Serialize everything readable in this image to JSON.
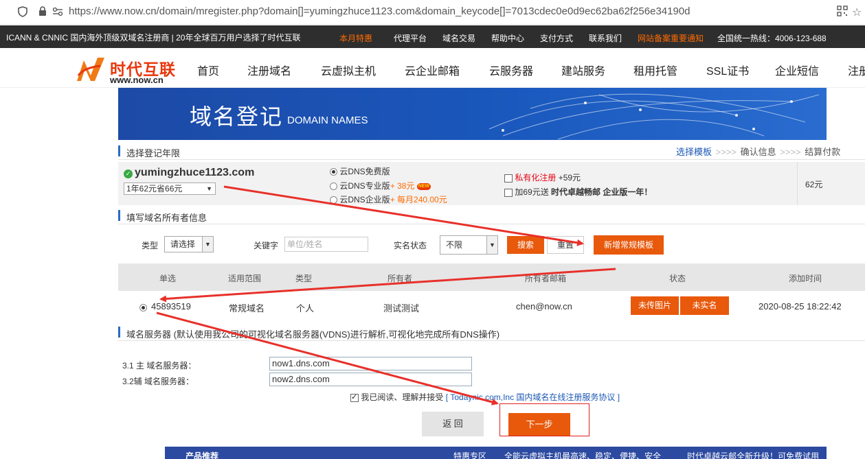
{
  "browser": {
    "url": "https://www.now.cn/domain/mregister.php?domain[]=yumingzhuce1123.com&domain_keycode[]=7013cdec0e0d9ec62ba62f256e34190d"
  },
  "topbar": {
    "slogan": "ICANN & CNNIC 国内海外顶级双域名注册商 | 20年全球百万用户选择了时代互联",
    "links": [
      "本月特惠",
      "代理平台",
      "域名交易",
      "帮助中心",
      "支付方式",
      "联系我们",
      "网站备案重要通知"
    ],
    "hotline": "全国统一热线：4006-123-688"
  },
  "logo": {
    "name": "时代互联",
    "url": "www.now.cn"
  },
  "nav": [
    "首页",
    "注册域名",
    "云虚拟主机",
    "云企业邮箱",
    "云服务器",
    "建站服务",
    "租用托管",
    "SSL证书",
    "企业短信",
    "注册"
  ],
  "banner": {
    "title": "域名登记",
    "subtitle": "DOMAIN NAMES"
  },
  "section1": {
    "title": "选择登记年限"
  },
  "steps": [
    "选择模板",
    "确认信息",
    "结算付款"
  ],
  "step_sep": ">>>>",
  "domain": {
    "name": "yumingzhuce1123.com",
    "check": "✓",
    "year_option": "1年62元省66元",
    "dns_options": [
      {
        "label": "云DNS免费版",
        "extra": "",
        "checked": true
      },
      {
        "label": "云DNS专业版",
        "extra": "+ 38元",
        "badge": "NEW",
        "checked": false
      },
      {
        "label": "云DNS企业版",
        "extra": "+ 每月240.00元",
        "checked": false
      }
    ],
    "private_reg": {
      "label": "私有化注册",
      "extra": "+59元"
    },
    "mail_offer": {
      "label": "加69元送",
      "bold": "时代卓越畅邮 企业版一年！"
    },
    "price": "62元"
  },
  "section2": {
    "title": "填写域名所有者信息"
  },
  "filter": {
    "type_label": "类型",
    "type_value": "请选择",
    "keyword_label": "关键字",
    "keyword_placeholder": "单位/姓名",
    "status_label": "实名状态",
    "status_value": "不限",
    "search_btn": "搜索",
    "reset_btn": "重置",
    "new_btn": "新增常规模板"
  },
  "table": {
    "headers": [
      "单选",
      "适用范围",
      "类型",
      "所有者",
      "所有者邮箱",
      "状态",
      "添加时间"
    ],
    "rows": [
      {
        "id": "45893519",
        "scope": "常规域名",
        "type": "个人",
        "owner": "测试测试",
        "email": "chen@now.cn",
        "status1": "未传图片",
        "status2": "未实名",
        "time": "2020-08-25 18:22:42",
        "selected": true
      }
    ]
  },
  "section3": {
    "title": "域名服务器 (默认使用我公司的可视化域名服务器(VDNS)进行解析,可视化地完成所有DNS操作)"
  },
  "dns": [
    {
      "label": "3.1 主 域名服务器：",
      "value": "now1.dns.com"
    },
    {
      "label": "3.2辅 域名服务器：",
      "value": "now2.dns.com"
    }
  ],
  "agree": {
    "text": "我已阅读、理解并接受",
    "link": "[ Todaynic.com,Inc 国内域名在线注册服务协议 ]"
  },
  "buttons": {
    "back": "返 回",
    "next": "下一步"
  },
  "bottom": {
    "title": "产品推荐",
    "links": [
      "特惠专区",
      "全能云虚拟主机最高速、稳定、便捷、安全",
      "时代卓越云邮全新升级！可免费试用"
    ]
  },
  "colors": {
    "accent": "#e8590c",
    "blue": "#1a57b4",
    "annotation_arrow": "#e8302a"
  }
}
